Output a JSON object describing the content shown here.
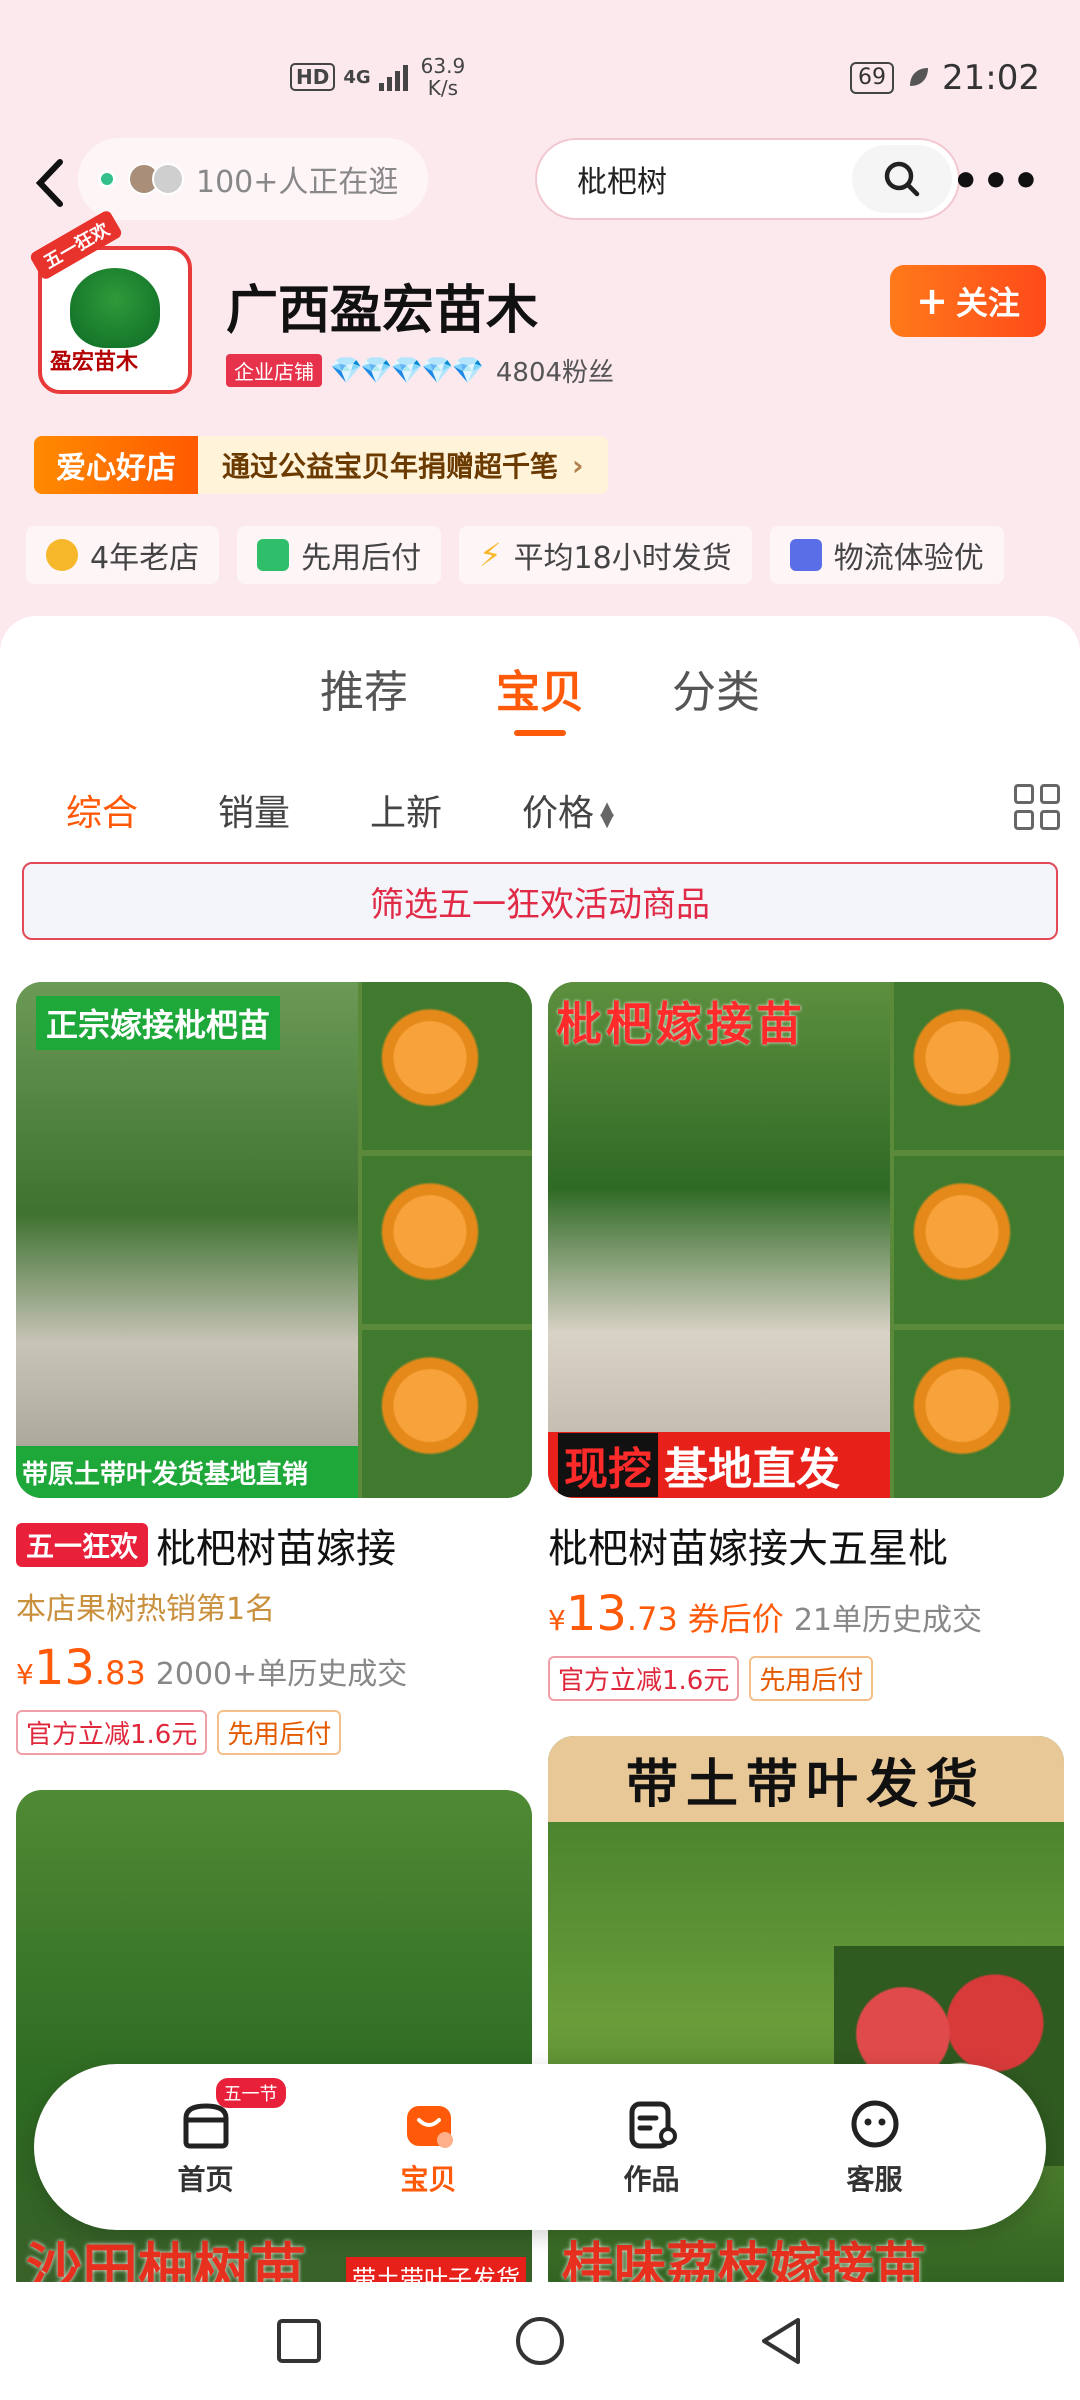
{
  "status_bar": {
    "hd": "HD",
    "net_type": "4G",
    "speed_value": "63.9",
    "speed_unit": "K/s",
    "battery": "69",
    "time": "21:02"
  },
  "header": {
    "visitors_text": "100+人正在逛",
    "search_query": "枇杷树"
  },
  "shop": {
    "ribbon": "五一狂欢",
    "logo_text": "盈宏苗木",
    "name": "广西盈宏苗木",
    "follow_label": "关注",
    "enterprise_badge": "企业店铺",
    "diamonds": "💎💎💎💎💎",
    "fans": "4804粉丝",
    "charity_tag": "爱心好店",
    "charity_msg": "通过公益宝贝年捐赠超千笔",
    "perks": [
      "4年老店",
      "先用后付",
      "平均18小时发货",
      "物流体验优"
    ]
  },
  "tabs": [
    "推荐",
    "宝贝",
    "分类"
  ],
  "active_tab": "宝贝",
  "sorts": [
    "综合",
    "销量",
    "上新",
    "价格"
  ],
  "filter_label": "筛选五一狂欢活动商品",
  "products": [
    {
      "img_top": "正宗嫁接枇杷苗",
      "img_bottom": "带原土带叶发货基地直销",
      "promo_tag": "五一狂欢",
      "title": "枇杷树苗嫁接",
      "subtitle": "本店果树热销第1名",
      "price_int": "13",
      "price_dec": ".83",
      "price_note": "",
      "sold": "2000+单历史成交",
      "chips": [
        "官方立减1.6元",
        "先用后付"
      ]
    },
    {
      "img_top": "枇杷嫁接苗",
      "img_bottom_a": "现挖",
      "img_bottom_b": "基地直发",
      "title": "枇杷树苗嫁接大五星枇",
      "price_int": "13",
      "price_dec": ".73",
      "price_note": "券后价",
      "sold": "21单历史成交",
      "chips": [
        "官方立减1.6元",
        "先用后付"
      ]
    },
    {
      "img_bottom": "沙田柚树苗",
      "img_side_label": "带土带叶子发货"
    },
    {
      "img_top": "带土带叶发货",
      "img_bottom": "桂味荔枝嫁接苗"
    }
  ],
  "tabbar": [
    {
      "label": "首页",
      "badge": "五一节"
    },
    {
      "label": "宝贝"
    },
    {
      "label": "作品"
    },
    {
      "label": "客服"
    }
  ],
  "colors": {
    "accent": "#ff5a0a",
    "background": "#fce9ee",
    "promo_red": "#e8203a"
  }
}
